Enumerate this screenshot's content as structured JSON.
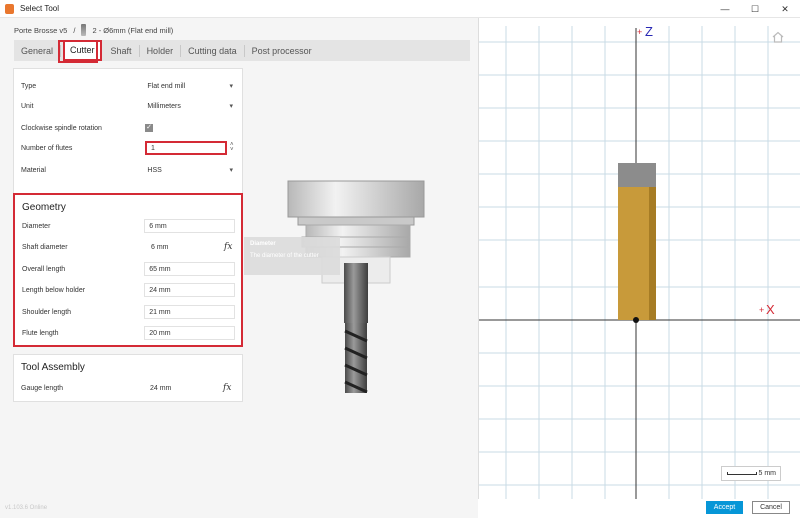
{
  "window": {
    "title": "Select Tool",
    "minimize": "—",
    "maximize": "☐",
    "close": "✕"
  },
  "breadcrumb": {
    "library": "Porte Brosse v5",
    "separator": "/",
    "tool": "2 - Ø6mm (Flat end mill)"
  },
  "tabs": [
    {
      "label": "General"
    },
    {
      "label": "Cutter",
      "active": true
    },
    {
      "label": "Shaft"
    },
    {
      "label": "Holder"
    },
    {
      "label": "Cutting data"
    },
    {
      "label": "Post processor"
    }
  ],
  "cutter": {
    "type_label": "Type",
    "type_value": "Flat end mill",
    "unit_label": "Unit",
    "unit_value": "Millimeters",
    "cw_label": "Clockwise spindle rotation",
    "cw_checked": "✓",
    "flutes_label": "Number of flutes",
    "flutes_value": "1",
    "material_label": "Material",
    "material_value": "HSS"
  },
  "geometry": {
    "title": "Geometry",
    "diameter_label": "Diameter",
    "diameter_value": "6 mm",
    "shaft_label": "Shaft diameter",
    "shaft_value": "6 mm",
    "overall_label": "Overall length",
    "overall_value": "65 mm",
    "below_label": "Length below holder",
    "below_value": "24 mm",
    "shoulder_label": "Shoulder length",
    "shoulder_value": "21 mm",
    "flute_label": "Flute length",
    "flute_value": "20 mm",
    "fx": "fx"
  },
  "assembly": {
    "title": "Tool Assembly",
    "gauge_label": "Gauge length",
    "gauge_value": "24 mm",
    "fx": "fx"
  },
  "tooltip": {
    "title": "Diameter",
    "text": "The diameter of the cutter"
  },
  "version": "v1.103.6 Online",
  "viewport": {
    "z_label": "Z",
    "x_label": "X",
    "plus": "+",
    "scale_label": "5 mm"
  },
  "buttons": {
    "accept": "Accept",
    "cancel": "Cancel"
  },
  "colors": {
    "accent_red": "#d42a35",
    "accept_blue": "#0696d7",
    "axis_blue": "#2828b4",
    "tool_gold": "#c89a3a"
  }
}
